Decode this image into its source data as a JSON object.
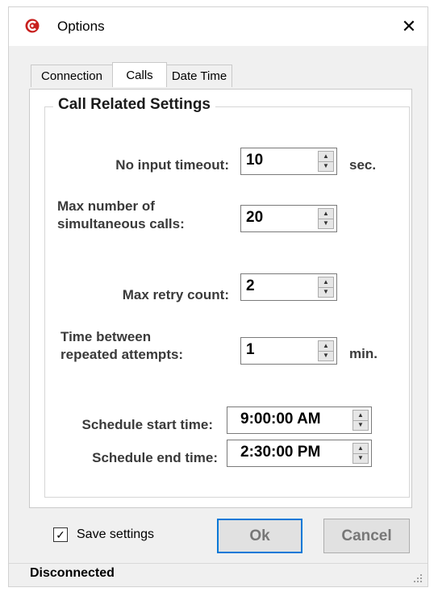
{
  "window": {
    "title": "Options",
    "close_glyph": "✕"
  },
  "icons": {
    "app": "app-logo-icon",
    "close": "close-icon"
  },
  "tabs": [
    {
      "label": "Connection"
    },
    {
      "label": "Calls",
      "active": true
    },
    {
      "label": "Date Time"
    }
  ],
  "group": {
    "title": "Call Related Settings"
  },
  "fields": {
    "no_input_timeout": {
      "label": "No input timeout:",
      "value": "10",
      "unit": "sec."
    },
    "max_calls": {
      "label_line1": "Max number of",
      "label_line2": "simultaneous calls:",
      "value": "20"
    },
    "max_retry": {
      "label": "Max retry count:",
      "value": "2"
    },
    "time_between": {
      "label_line1": "Time between",
      "label_line2": "repeated attempts:",
      "value": "1",
      "unit": "min."
    },
    "schedule_start": {
      "label": "Schedule start time:",
      "value": "9:00:00 AM"
    },
    "schedule_end": {
      "label": "Schedule end time:",
      "value": "2:30:00 PM"
    }
  },
  "footer": {
    "save_settings_label": "Save settings",
    "save_settings_checked": true,
    "check_glyph": "✓",
    "ok_label": "Ok",
    "cancel_label": "Cancel"
  },
  "status": {
    "text": "Disconnected"
  },
  "colors": {
    "accent": "#0078d7",
    "app_icon": "#c8201e"
  }
}
